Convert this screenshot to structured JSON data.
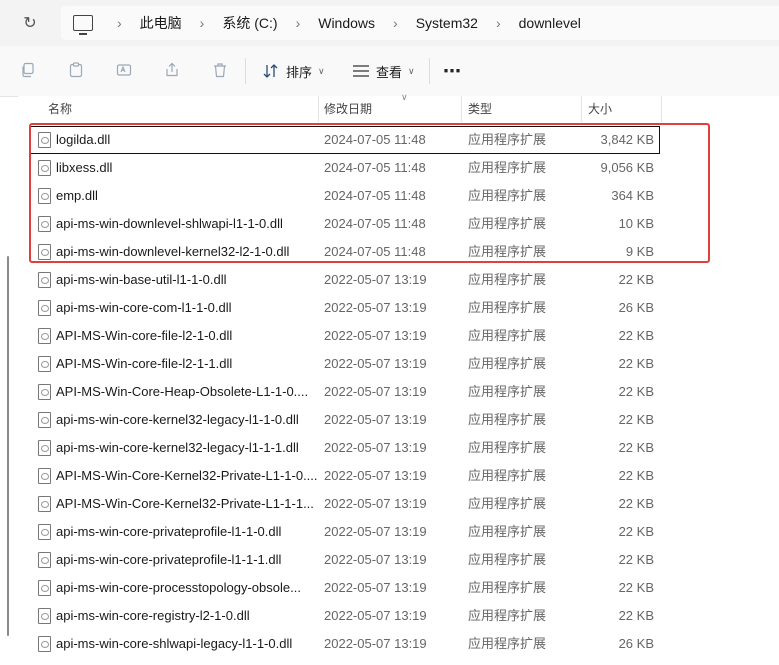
{
  "address_bar": {
    "breadcrumbs": [
      "此电脑",
      "系统 (C:)",
      "Windows",
      "System32",
      "downlevel"
    ]
  },
  "toolbar": {
    "sort_label": "排序",
    "view_label": "查看"
  },
  "columns": {
    "name": "名称",
    "modified": "修改日期",
    "type": "类型",
    "size": "大小"
  },
  "files": [
    {
      "name": "logilda.dll",
      "modified": "2024-07-05 11:48",
      "type": "应用程序扩展",
      "size": "3,842 KB"
    },
    {
      "name": "libxess.dll",
      "modified": "2024-07-05 11:48",
      "type": "应用程序扩展",
      "size": "9,056 KB"
    },
    {
      "name": "emp.dll",
      "modified": "2024-07-05 11:48",
      "type": "应用程序扩展",
      "size": "364 KB"
    },
    {
      "name": "api-ms-win-downlevel-shlwapi-l1-1-0.dll",
      "modified": "2024-07-05 11:48",
      "type": "应用程序扩展",
      "size": "10 KB"
    },
    {
      "name": "api-ms-win-downlevel-kernel32-l2-1-0.dll",
      "modified": "2024-07-05 11:48",
      "type": "应用程序扩展",
      "size": "9 KB"
    },
    {
      "name": "api-ms-win-base-util-l1-1-0.dll",
      "modified": "2022-05-07 13:19",
      "type": "应用程序扩展",
      "size": "22 KB"
    },
    {
      "name": "api-ms-win-core-com-l1-1-0.dll",
      "modified": "2022-05-07 13:19",
      "type": "应用程序扩展",
      "size": "26 KB"
    },
    {
      "name": "API-MS-Win-core-file-l2-1-0.dll",
      "modified": "2022-05-07 13:19",
      "type": "应用程序扩展",
      "size": "22 KB"
    },
    {
      "name": "API-MS-Win-core-file-l2-1-1.dll",
      "modified": "2022-05-07 13:19",
      "type": "应用程序扩展",
      "size": "22 KB"
    },
    {
      "name": "API-MS-Win-Core-Heap-Obsolete-L1-1-0....",
      "modified": "2022-05-07 13:19",
      "type": "应用程序扩展",
      "size": "22 KB"
    },
    {
      "name": "api-ms-win-core-kernel32-legacy-l1-1-0.dll",
      "modified": "2022-05-07 13:19",
      "type": "应用程序扩展",
      "size": "22 KB"
    },
    {
      "name": "api-ms-win-core-kernel32-legacy-l1-1-1.dll",
      "modified": "2022-05-07 13:19",
      "type": "应用程序扩展",
      "size": "22 KB"
    },
    {
      "name": "API-MS-Win-Core-Kernel32-Private-L1-1-0....",
      "modified": "2022-05-07 13:19",
      "type": "应用程序扩展",
      "size": "22 KB"
    },
    {
      "name": "API-MS-Win-Core-Kernel32-Private-L1-1-1...",
      "modified": "2022-05-07 13:19",
      "type": "应用程序扩展",
      "size": "22 KB"
    },
    {
      "name": "api-ms-win-core-privateprofile-l1-1-0.dll",
      "modified": "2022-05-07 13:19",
      "type": "应用程序扩展",
      "size": "22 KB"
    },
    {
      "name": "api-ms-win-core-privateprofile-l1-1-1.dll",
      "modified": "2022-05-07 13:19",
      "type": "应用程序扩展",
      "size": "22 KB"
    },
    {
      "name": "api-ms-win-core-processtopology-obsole...",
      "modified": "2022-05-07 13:19",
      "type": "应用程序扩展",
      "size": "22 KB"
    },
    {
      "name": "api-ms-win-core-registry-l2-1-0.dll",
      "modified": "2022-05-07 13:19",
      "type": "应用程序扩展",
      "size": "22 KB"
    },
    {
      "name": "api-ms-win-core-shlwapi-legacy-l1-1-0.dll",
      "modified": "2022-05-07 13:19",
      "type": "应用程序扩展",
      "size": "26 KB"
    }
  ],
  "selected_index": 0,
  "highlight_color": "#e0403a"
}
